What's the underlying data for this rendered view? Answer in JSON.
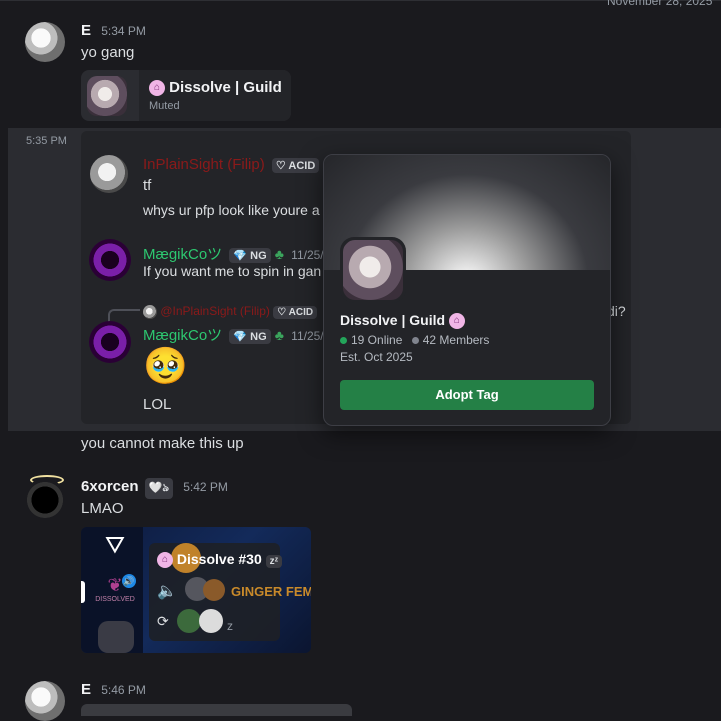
{
  "date_divider": "November 28, 2025",
  "msg1": {
    "author": "E",
    "time": "5:34 PM",
    "text": "yo gang"
  },
  "guild_embed": {
    "name": "Dissolve | Guild",
    "status": "Muted"
  },
  "hover_time": "5:35 PM",
  "quoted": {
    "filip": {
      "author": "InPlainSight (Filip)",
      "tag": "ACID",
      "line1": "tf",
      "line2": "whys ur pfp look like youre a"
    },
    "mae1": {
      "author": "MægikCoツ",
      "tag": "NG",
      "time": "11/25/",
      "text": "If you want me to spin in gan"
    },
    "reply_ref": {
      "author": "@InPlainSight (Filip)",
      "tag": "ACID"
    },
    "mae2": {
      "author": "MægikCoツ",
      "tag": "NG",
      "time": "11/25/",
      "emoji": "🥹",
      "text": "LOL"
    },
    "overflow_text": "di?"
  },
  "popup": {
    "guild_name": "Dissolve | Guild",
    "online": "19 Online",
    "members": "42 Members",
    "established": "Est. Oct 2025",
    "button": "Adopt Tag"
  },
  "msg2": {
    "text": "you cannot make this up"
  },
  "msg3": {
    "author": "6xorcen",
    "badge": "🤍ঌ",
    "time": "5:42 PM",
    "text": "LMAO"
  },
  "voice_card": {
    "title": "Dissolve #30",
    "zz": "zᶻ",
    "brand": "GINGER FEM",
    "server": "DISSOLVED",
    "z": "z"
  },
  "msg4": {
    "author": "E",
    "time": "5:46 PM"
  },
  "colors": {
    "online": "#23a55a",
    "button": "#248046",
    "filip_name": "#8b1a1a",
    "mae_name": "#2dc770"
  }
}
